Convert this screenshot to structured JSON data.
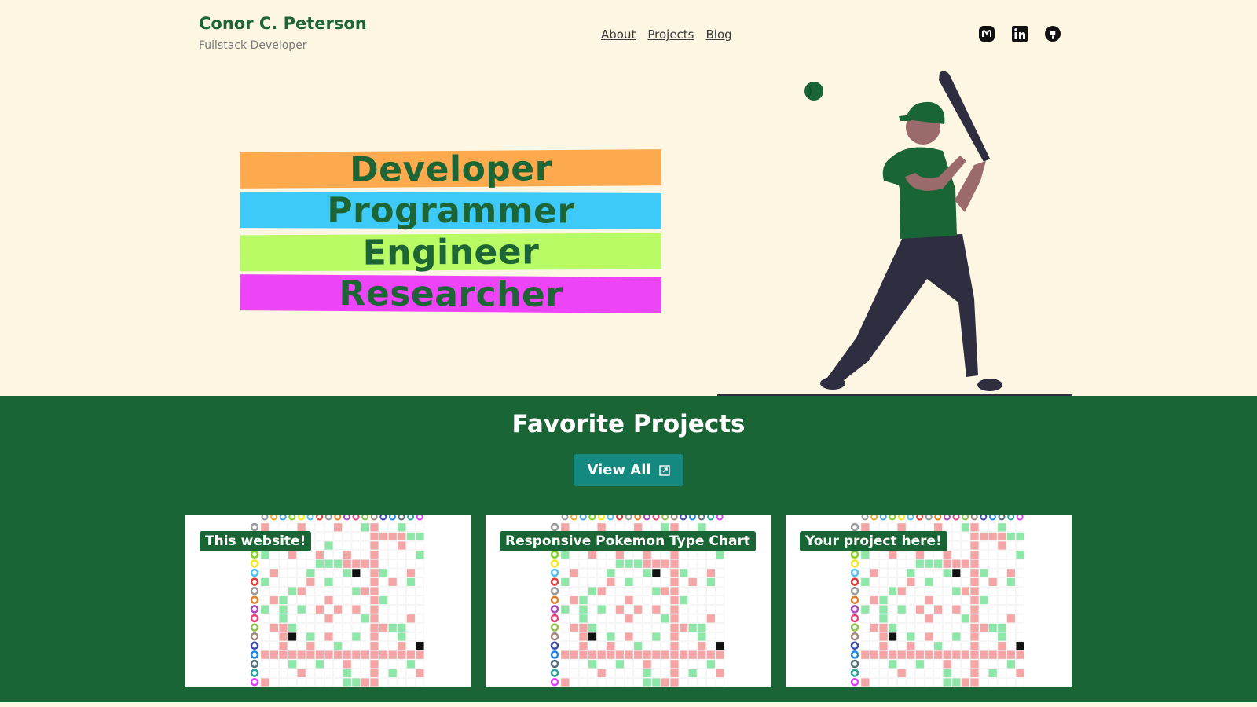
{
  "header": {
    "name": "Conor C. Peterson",
    "subtitle": "Fullstack Developer",
    "nav": [
      "About",
      "Projects",
      "Blog"
    ],
    "social": [
      "mastodon-icon",
      "linkedin-icon",
      "github-icon"
    ]
  },
  "hero": {
    "titles": [
      "Developer",
      "Programmer",
      "Engineer",
      "Researcher"
    ],
    "band_colors": [
      "#fdaa4e",
      "#3ecaf8",
      "#b8fb65",
      "#ec44f6"
    ]
  },
  "projects": {
    "heading": "Favorite Projects",
    "view_all": "View All",
    "cards": [
      {
        "label": "This website!"
      },
      {
        "label": "Responsive Pokemon Type Chart"
      },
      {
        "label": "Your project here!"
      }
    ]
  },
  "colors": {
    "background": "#fdf6e3",
    "brand_green": "#1d6535",
    "section_green": "#196535",
    "button_teal": "#13897f"
  }
}
